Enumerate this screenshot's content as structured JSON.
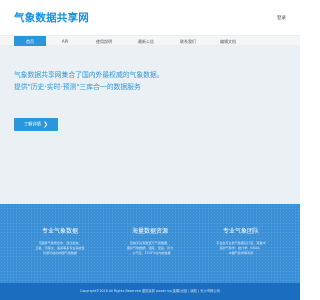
{
  "header": {
    "site_title": "气象数据共享网",
    "login_label": "登录"
  },
  "nav": {
    "items": [
      {
        "label": "首页",
        "active": true
      },
      {
        "label": "API",
        "active": false
      },
      {
        "label": "使用說明",
        "active": false
      },
      {
        "label": "最新公告",
        "active": false
      },
      {
        "label": "联系我们",
        "active": false
      },
      {
        "label": "编辑文档",
        "active": false
      }
    ]
  },
  "hero": {
    "line1": "气象数据共享网集合了国内外最权威的气象数据。",
    "line2": "提供\"历史-实时-预测\"三库合一的数据服务",
    "button_label": "了解详情",
    "button_arrow": "❯"
  },
  "features": [
    {
      "title": "专业气象数据",
      "desc": [
        "与国家气象局合作，通过爬虫、",
        "卫星、示踪仪、遥感等多专业来收集",
        "优质可信的中国气象数据"
      ]
    },
    {
      "title": "海量数据资源",
      "desc": [
        "目前平台有数百万气象数据，",
        "国际气象数据，温度、湿度、风力",
        "、大气压、ECGF5在内的数据"
      ]
    },
    {
      "title": "专业气象团队",
      "desc": [
        "平台由专业的气象团队打造，有着丰",
        "富的气象学、统计学、NOAA、",
        "中国气象局等专家"
      ]
    }
  ],
  "footer": {
    "copyright": "Copyright©2018 All Rights Reserved 重庆民邦 power by(金耀)出品 | 版权 | 长沙市网公司"
  }
}
